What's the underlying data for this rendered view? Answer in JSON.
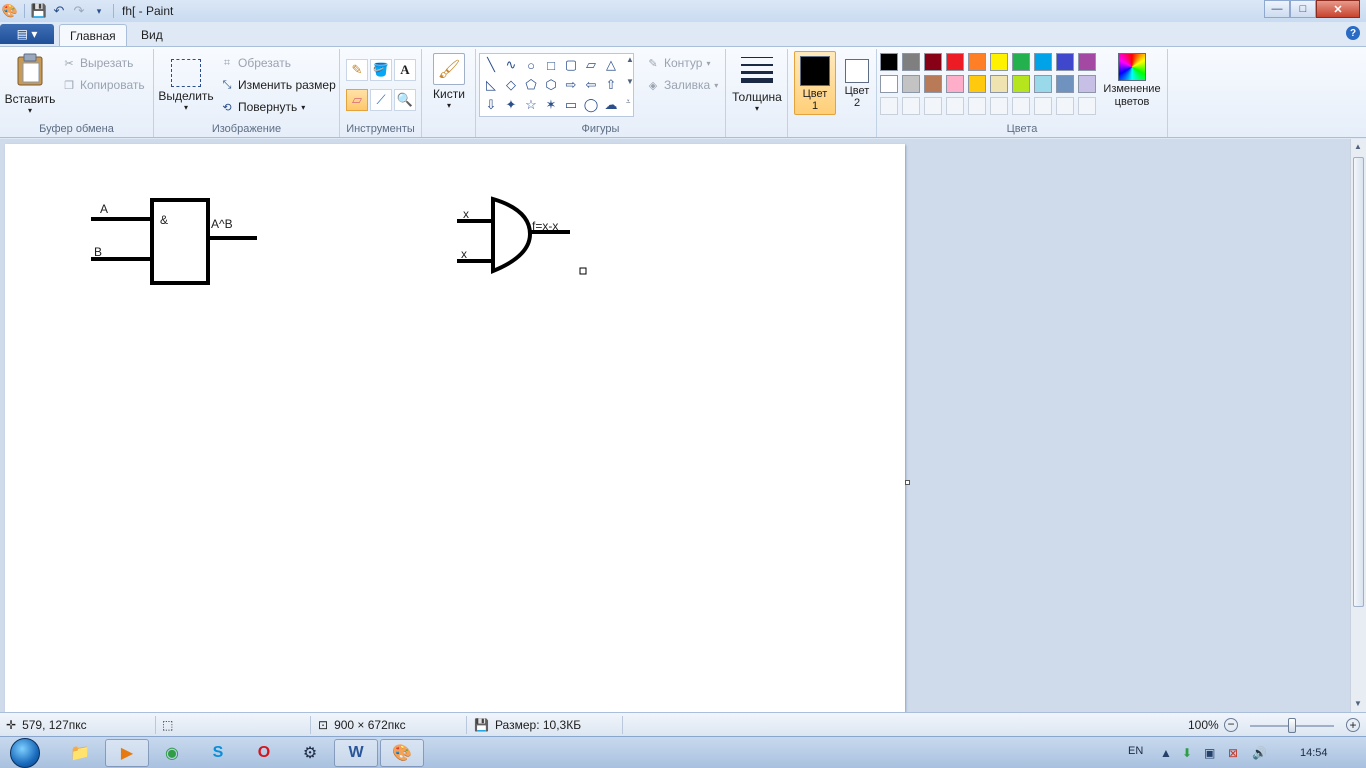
{
  "titlebar": {
    "title": "fh[ - Paint",
    "controls": {
      "minimize": "—",
      "maximize": "□",
      "close": "✕"
    }
  },
  "tabs": {
    "file_menu": "▤ ▾",
    "items": [
      "Главная",
      "Вид"
    ],
    "help": "?"
  },
  "ribbon": {
    "clipboard": {
      "label": "Буфер обмена",
      "paste": "Вставить",
      "cut": "Вырезать",
      "copy": "Копировать"
    },
    "image": {
      "label": "Изображение",
      "select": "Выделить",
      "crop": "Обрезать",
      "resize": "Изменить размер",
      "rotate": "Повернуть"
    },
    "tools": {
      "label": "Инструменты"
    },
    "brushes": {
      "label": "Кисти"
    },
    "shapes": {
      "label": "Фигуры",
      "outline": "Контур",
      "fill": "Заливка",
      "glyphs": [
        "╲",
        "∿",
        "○",
        "□",
        "▢",
        "▱",
        "△",
        "◺",
        "◇",
        "⬠",
        "⬡",
        "⇨",
        "⇦",
        "⇧",
        "⇩",
        "✦",
        "☆",
        "✶",
        "▭",
        "◯",
        "☁"
      ]
    },
    "size": {
      "label": "Толщина"
    },
    "color1": {
      "label": "Цвет 1",
      "color": "#000000"
    },
    "color2": {
      "label": "Цвет 2",
      "color": "#ffffff"
    },
    "colors": {
      "label": "Цвета",
      "edit": "Изменение цветов",
      "row1": [
        "#000000",
        "#7f7f7f",
        "#880015",
        "#ed1c24",
        "#ff7f27",
        "#fff200",
        "#22b14c",
        "#00a2e8",
        "#3f48cc",
        "#a349a4"
      ],
      "row2": [
        "#ffffff",
        "#c3c3c3",
        "#b97a57",
        "#ffaec9",
        "#ffc90e",
        "#efe4b0",
        "#b5e61d",
        "#99d9ea",
        "#7092be",
        "#c8bfe7"
      ]
    }
  },
  "canvas": {
    "gate1": {
      "input_a": "A",
      "input_b": "B",
      "symbol": "&",
      "output": "A^B"
    },
    "gate2": {
      "input_1": "x",
      "input_2": "x",
      "output": "f=x-x"
    }
  },
  "statusbar": {
    "cursor": "579, 127пкс",
    "selection": "",
    "canvas_size": "900 × 672пкс",
    "file_size": "Размер: 10,3КБ",
    "zoom": "100%"
  },
  "taskbar": {
    "lang": "EN",
    "clock": "14:54"
  }
}
